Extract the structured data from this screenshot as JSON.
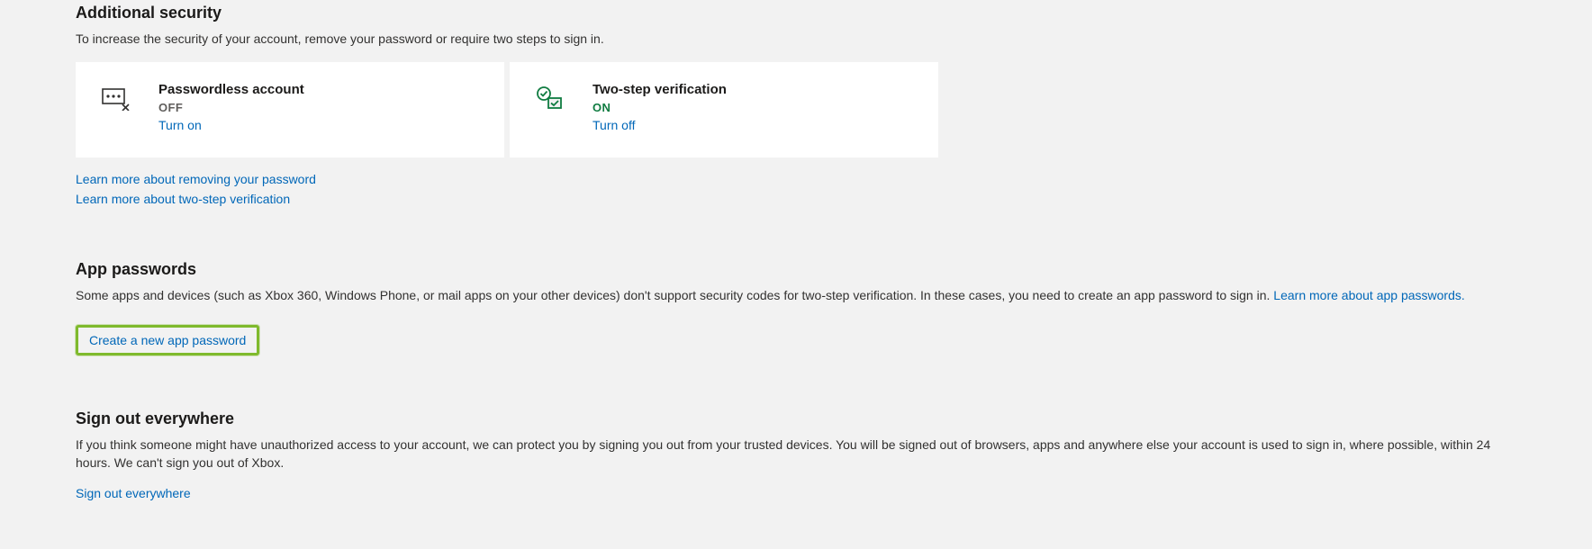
{
  "additional_security": {
    "title": "Additional security",
    "subtitle": "To increase the security of your account, remove your password or require two steps to sign in.",
    "passwordless": {
      "title": "Passwordless account",
      "status": "OFF",
      "action": "Turn on"
    },
    "two_step": {
      "title": "Two-step verification",
      "status": "ON",
      "action": "Turn off"
    },
    "learn_remove_password": "Learn more about removing your password",
    "learn_two_step": "Learn more about two-step verification"
  },
  "app_passwords": {
    "title": "App passwords",
    "desc_pre": "Some apps and devices (such as Xbox 360, Windows Phone, or mail apps on your other devices) don't support security codes for two-step verification. In these cases, you need to create an app password to sign in. ",
    "learn_link": "Learn more about app passwords.",
    "create_link": "Create a new app password"
  },
  "sign_out": {
    "title": "Sign out everywhere",
    "desc": "If you think someone might have unauthorized access to your account, we can protect you by signing you out from your trusted devices. You will be signed out of browsers, apps and anywhere else your account is used to sign in, where possible, within 24 hours. We can't sign you out of Xbox.",
    "link": "Sign out everywhere"
  }
}
